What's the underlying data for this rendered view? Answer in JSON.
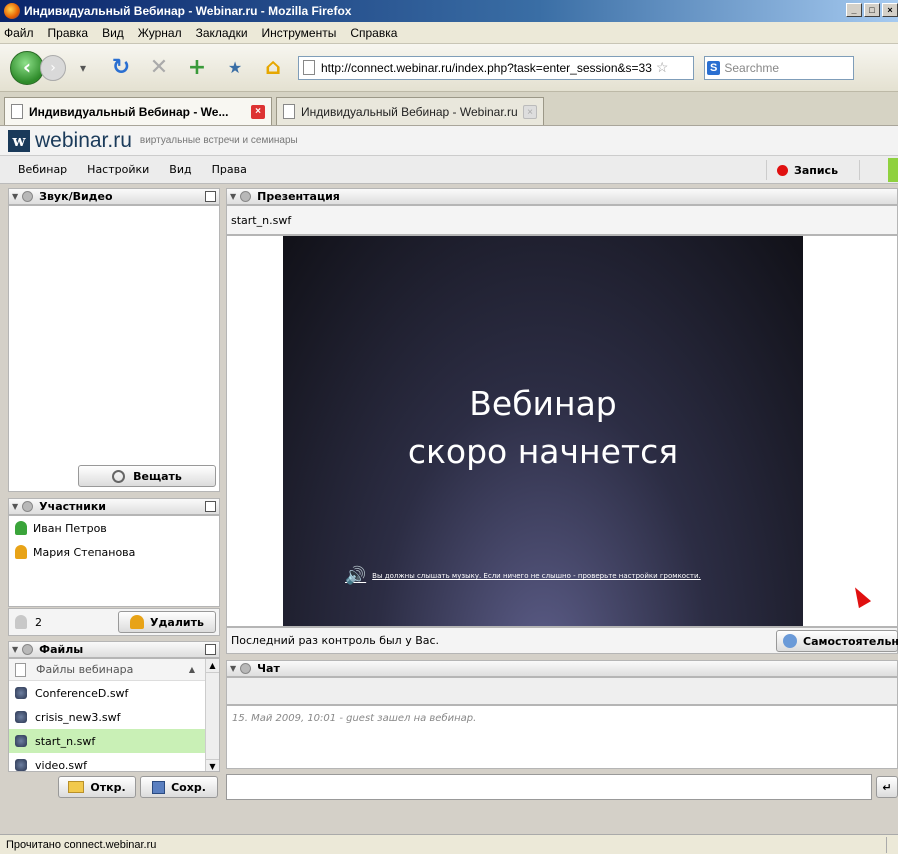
{
  "window": {
    "title": "Индивидуальный Вебинар - Webinar.ru - Mozilla Firefox"
  },
  "menu": [
    "Файл",
    "Правка",
    "Вид",
    "Журнал",
    "Закладки",
    "Инструменты",
    "Справка"
  ],
  "nav": {
    "url": "http://connect.webinar.ru/index.php?task=enter_session&s=33",
    "search_placeholder": "Searchme"
  },
  "tabs": [
    {
      "label": "Индивидуальный Вебинар - We..."
    },
    {
      "label": "Индивидуальный Вебинар - Webinar.ru"
    }
  ],
  "brand": {
    "name": "webinar.ru",
    "tagline": "виртуальные встречи и семинары",
    "logo_letter": "w"
  },
  "app_menu": [
    "Вебинар",
    "Настройки",
    "Вид",
    "Права"
  ],
  "record_label": "Запись",
  "panels": {
    "av": {
      "title": "Звук/Видео",
      "broadcast_button": "Вещать"
    },
    "participants": {
      "title": "Участники",
      "list": [
        {
          "name": "Иван Петров",
          "color": "#3aa43a"
        },
        {
          "name": "Мария Степанова",
          "color": "#e8a317"
        }
      ],
      "count": "2",
      "remove_button": "Удалить"
    },
    "files": {
      "title": "Файлы",
      "header": "Файлы вебинара",
      "list": [
        "ConferenceD.swf",
        "crisis_new3.swf",
        "start_n.swf",
        "video.swf"
      ],
      "selected": 2,
      "open_button": "Откр.",
      "save_button": "Сохр."
    },
    "presentation": {
      "title": "Презентация",
      "file": "start_n.swf",
      "slide_line1": "Вебинар",
      "slide_line2": "скоро начнется",
      "slide_note": "Вы должны слышать музыку. Если ничего не слышно - проверьте настройки громкости.",
      "control_text": "Последний раз контроль был у Вас.",
      "self_button": "Самостоятельно"
    },
    "chat": {
      "title": "Чат",
      "message": "15. Май 2009, 10:01 - guest зашел на вебинар."
    }
  },
  "status": "Прочитано connect.webinar.ru",
  "colors": {
    "accent_green": "#8fd13f",
    "record_red": "#e01010",
    "selected_row": "#c9f0b6"
  }
}
